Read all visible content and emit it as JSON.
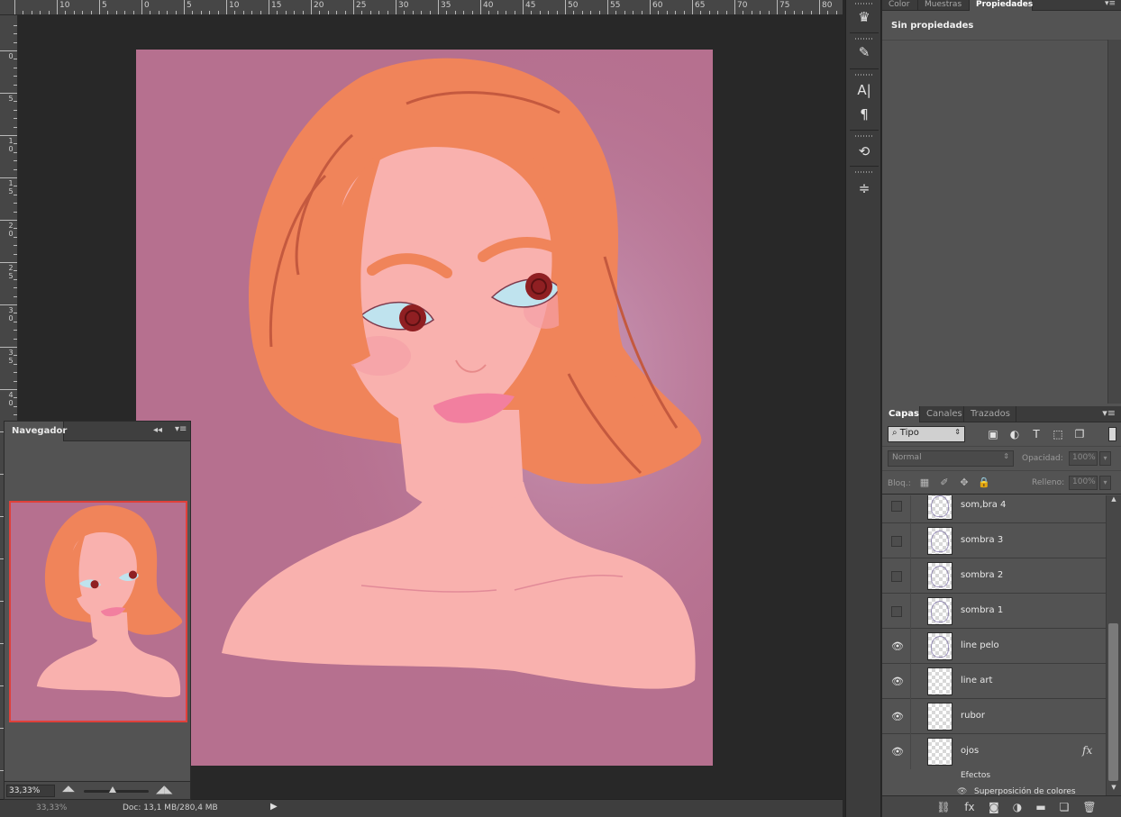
{
  "ruler_h_labels": [
    "10",
    "5",
    "0",
    "5",
    "10",
    "15",
    "20",
    "25",
    "30",
    "35",
    "40",
    "45",
    "50",
    "55",
    "60",
    "65",
    "70",
    "75",
    "80"
  ],
  "ruler_v_labels": [
    "0",
    "5",
    "1\n0",
    "1\n5",
    "2\n0",
    "2\n5",
    "3\n0",
    "3\n5",
    "4\n0"
  ],
  "status": {
    "zoom_hidden": "33,33%",
    "doc": "Doc: 13,1 MB/280,4 MB",
    "menu_arrow": "▶"
  },
  "navigator": {
    "title": "Navegador",
    "collapse_icon": "◂◂",
    "menu_icon": "▾≡",
    "zoom_value": "33,33%",
    "zoom_out_icon": "mountain-small-icon",
    "zoom_in_icon": "mountain-large-icon",
    "view_box_color": "#e0403a"
  },
  "toolstrip": {
    "tools": [
      {
        "name": "brush-presets-icon",
        "glyph": "♛"
      },
      {
        "name": "brush-panel-icon",
        "glyph": "✎"
      },
      {
        "name": "character-icon",
        "glyph": "A|"
      },
      {
        "name": "paragraph-icon",
        "glyph": "¶"
      },
      {
        "name": "history-icon",
        "glyph": "⟲"
      },
      {
        "name": "adjustments-icon",
        "glyph": "≑"
      }
    ]
  },
  "properties_panel": {
    "tabs": [
      "Color",
      "Muestras",
      "Propiedades"
    ],
    "active_tab": "Propiedades",
    "menu_icon": "▾≡",
    "title": "Sin propiedades"
  },
  "layers_panel": {
    "tabs": [
      "Capas",
      "Canales",
      "Trazados"
    ],
    "active_tab": "Capas",
    "menu_icon": "▾≡",
    "filter": {
      "label": "⌕ Tipo",
      "arrow": "⇕"
    },
    "filter_icons": [
      {
        "name": "image-filter-icon",
        "glyph": "▣"
      },
      {
        "name": "adjustment-filter-icon",
        "glyph": "◐"
      },
      {
        "name": "type-filter-icon",
        "glyph": "T"
      },
      {
        "name": "shape-filter-icon",
        "glyph": "⬚"
      },
      {
        "name": "smart-object-filter-icon",
        "glyph": "❐"
      }
    ],
    "blend_mode": "Normal",
    "blend_arrow": "⇕",
    "opacity_label": "Opacidad:",
    "opacity_value": "100%",
    "lock_label": "Bloq.:",
    "lock_icons": [
      {
        "name": "lock-transparent-icon",
        "glyph": "▦"
      },
      {
        "name": "lock-pixels-icon",
        "glyph": "✐"
      },
      {
        "name": "lock-position-icon",
        "glyph": "✥"
      },
      {
        "name": "lock-all-icon",
        "glyph": "🔒"
      }
    ],
    "fill_label": "Relleno:",
    "fill_value": "100%",
    "drop_arrow": "▾",
    "layers": [
      {
        "name": "som,bra 4",
        "visible": false
      },
      {
        "name": "sombra 3",
        "visible": false
      },
      {
        "name": "sombra 2",
        "visible": false
      },
      {
        "name": "sombra 1",
        "visible": false
      },
      {
        "name": "line pelo",
        "visible": true
      },
      {
        "name": "line art",
        "visible": true
      },
      {
        "name": "rubor",
        "visible": true
      },
      {
        "name": "ojos",
        "visible": true,
        "fx": "fx"
      }
    ],
    "effects_label": "Efectos",
    "effect_item": "Superposición de colores",
    "bottom_icons": [
      {
        "name": "link-layers-icon",
        "glyph": "⛓"
      },
      {
        "name": "layer-style-icon",
        "glyph": "fx"
      },
      {
        "name": "add-mask-icon",
        "glyph": "◙"
      },
      {
        "name": "new-fill-layer-icon",
        "glyph": "◑"
      },
      {
        "name": "new-group-icon",
        "glyph": "▬"
      },
      {
        "name": "new-layer-icon",
        "glyph": "❏"
      },
      {
        "name": "delete-layer-icon",
        "glyph": "🗑"
      }
    ]
  },
  "colors": {
    "canvas_bg": "#b6708f",
    "hair": "#f0845a",
    "skin": "#f9b1ae",
    "eye_white": "#bfe3ee",
    "iris": "#8f1f22",
    "lips": "#f27f9f"
  }
}
